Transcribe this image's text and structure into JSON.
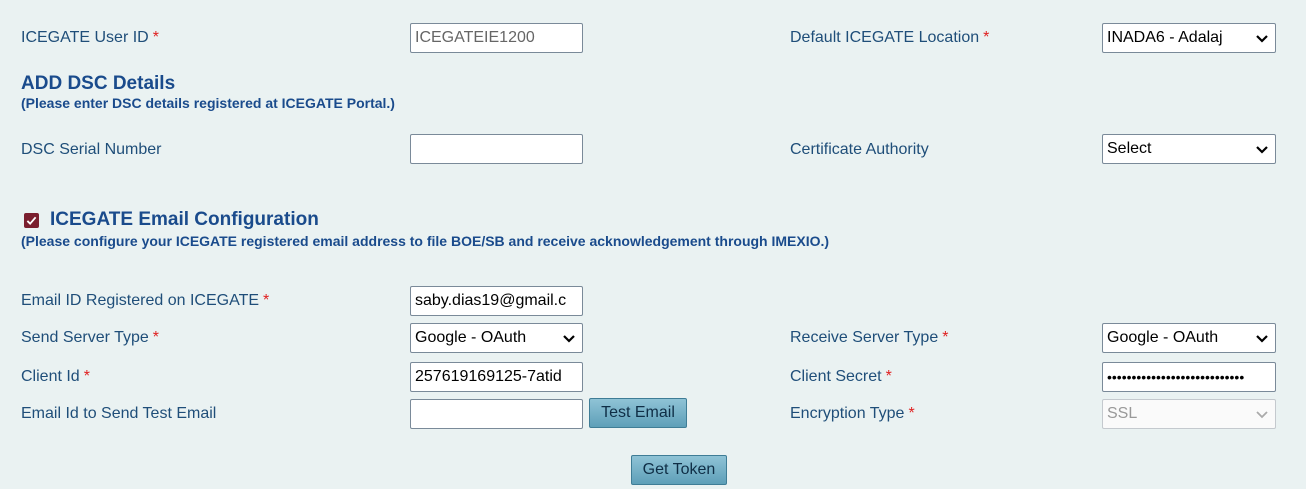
{
  "form": {
    "user_id": {
      "label": "ICEGATE User ID",
      "required": "*",
      "value": "ICEGATEIE1200"
    },
    "default_location": {
      "label": "Default ICEGATE Location",
      "required": "*",
      "value": "INADA6 - Adalaj"
    },
    "dsc": {
      "title": "ADD DSC Details",
      "subtitle": "(Please enter DSC details registered at ICEGATE Portal.)",
      "serial_label": "DSC Serial Number",
      "serial_value": "",
      "authority_label": "Certificate Authority",
      "authority_value": "Select"
    },
    "email_config": {
      "checked": true,
      "title": "ICEGATE Email Configuration",
      "subtitle": "(Please configure your ICEGATE registered email address to file BOE/SB and receive acknowledgement through IMEXIO.)",
      "email_label": "Email ID Registered on ICEGATE",
      "email_value": "saby.dias19@gmail.c",
      "send_server_label": "Send Server Type",
      "send_server_value": "Google - OAuth",
      "receive_server_label": "Receive Server Type",
      "receive_server_value": "Google - OAuth",
      "client_id_label": "Client Id",
      "client_id_value": "257619169125-7atid",
      "client_secret_label": "Client Secret",
      "client_secret_value": "••••••••••••••••••••••••••••",
      "test_email_label": "Email Id to Send Test Email",
      "test_email_value": "",
      "test_email_button": "Test Email",
      "encryption_label": "Encryption Type",
      "encryption_value": "SSL",
      "get_token_button": "Get Token",
      "required": "*"
    }
  },
  "colors": {
    "background": "#eaf2f2",
    "label": "#1f4e79",
    "heading": "#1a4b8c",
    "required": "#e02020",
    "button": "#6fb0c8"
  }
}
